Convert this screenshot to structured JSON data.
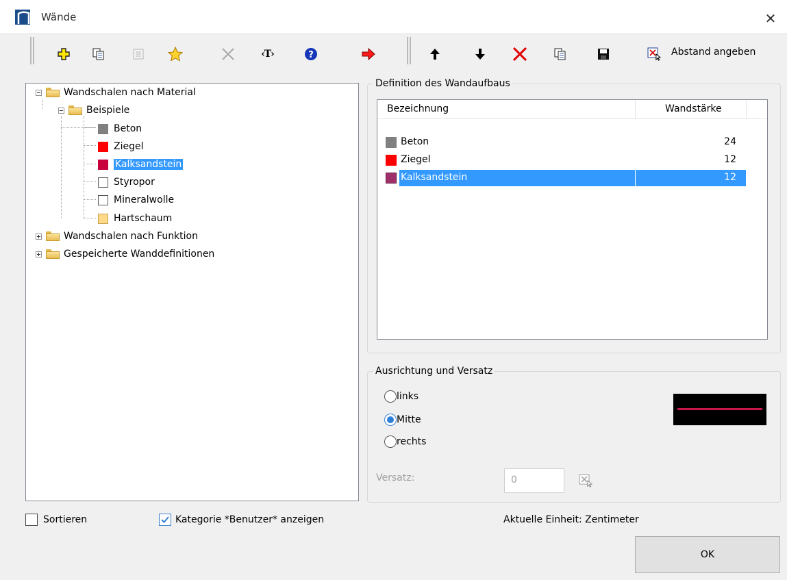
{
  "window": {
    "title": "Wände"
  },
  "toolbar": {
    "tools": [
      "add-icon",
      "copy-icon",
      "properties-icon",
      "favorite-star-icon",
      "delete-cross-icon",
      "text-tag-icon",
      "help-icon",
      "transfer-arrow-icon"
    ],
    "list_tools": [
      "move-up-icon",
      "move-down-icon",
      "remove-icon",
      "copy-icon",
      "save-icon"
    ],
    "abstand_label": "Abstand angeben"
  },
  "tree": {
    "root1": "Wandschalen nach Material",
    "beispiele": "Beispiele",
    "materials": [
      {
        "label": "Beton",
        "color": "#808080"
      },
      {
        "label": "Ziegel",
        "color": "#ff0000"
      },
      {
        "label": "Kalksandstein",
        "color": "#c8003c"
      },
      {
        "label": "Styropor",
        "color": "#ffffff"
      },
      {
        "label": "Mineralwolle",
        "color": "#ffffff"
      },
      {
        "label": "Hartschaum",
        "color": "#ffd98a"
      }
    ],
    "root2": "Wandschalen nach Funktion",
    "root3": "Gespeicherte Wanddefinitionen"
  },
  "definition": {
    "group_title": "Definition des Wandaufbaus",
    "columns": {
      "name": "Bezeichnung",
      "thickness": "Wandstärke"
    },
    "rows": [
      {
        "name": "Beton",
        "thickness": "24",
        "color": "#808080"
      },
      {
        "name": "Ziegel",
        "thickness": "12",
        "color": "#ff0000"
      },
      {
        "name": "Kalksandstein",
        "thickness": "12",
        "color": "#a0306a"
      }
    ]
  },
  "alignment": {
    "group_title": "Ausrichtung und Versatz",
    "options": [
      "links",
      "Mitte",
      "rechts"
    ],
    "selected": "Mitte",
    "offset_label": "Versatz:",
    "offset_value": "0"
  },
  "footer": {
    "sort_label": "Sortieren",
    "sort_checked": false,
    "category_label": "Kategorie *Benutzer* anzeigen",
    "category_checked": true,
    "unit_label": "Aktuelle Einheit: Zentimeter",
    "ok_label": "OK"
  }
}
